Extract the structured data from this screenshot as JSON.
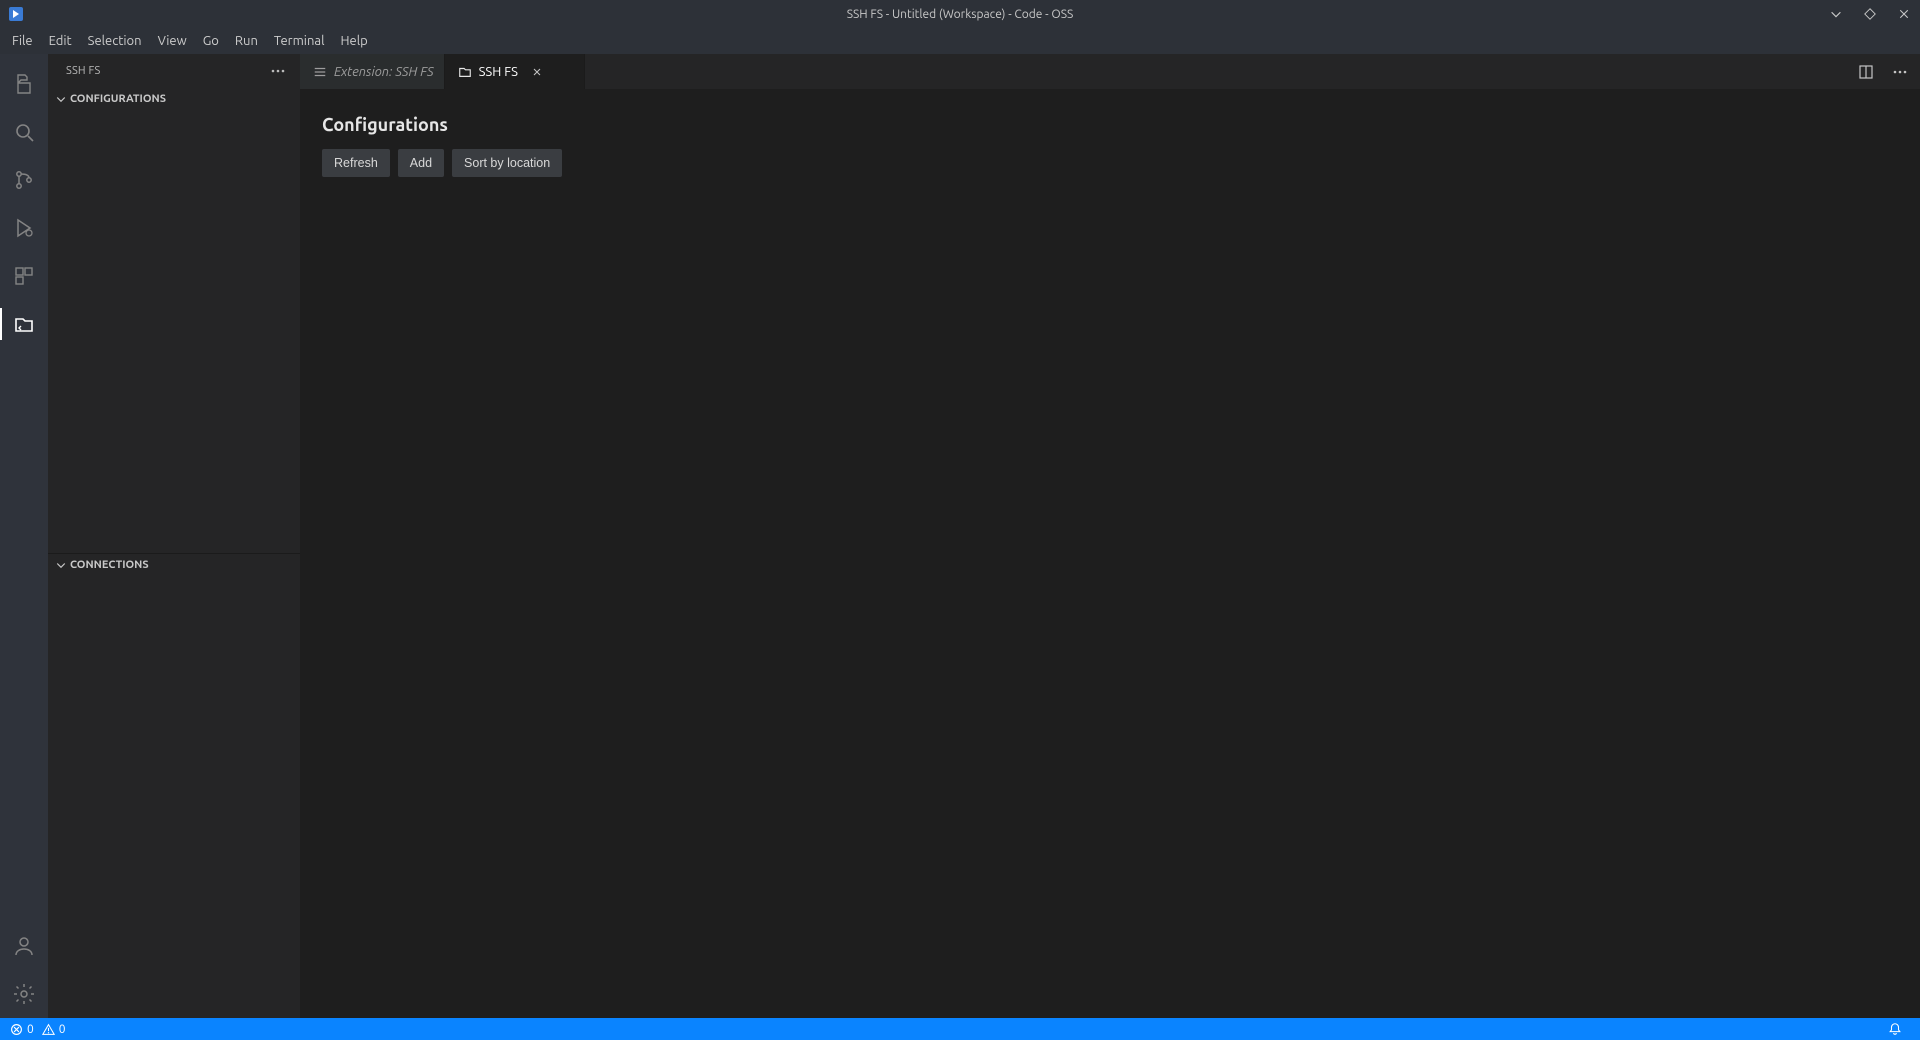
{
  "window": {
    "title": "SSH FS - Untitled (Workspace) - Code - OSS"
  },
  "menu": {
    "items": [
      "File",
      "Edit",
      "Selection",
      "View",
      "Go",
      "Run",
      "Terminal",
      "Help"
    ]
  },
  "sidebar": {
    "title": "SSH FS",
    "panels": {
      "configurations_label": "CONFIGURATIONS",
      "connections_label": "CONNECTIONS"
    }
  },
  "tabs": {
    "items": [
      {
        "label": "Extension: SSH FS",
        "active": false
      },
      {
        "label": "SSH FS",
        "active": true
      }
    ]
  },
  "editor": {
    "heading": "Configurations",
    "buttons": {
      "refresh": "Refresh",
      "add": "Add",
      "sort": "Sort by location"
    }
  },
  "status": {
    "errors": "0",
    "warnings": "0"
  }
}
